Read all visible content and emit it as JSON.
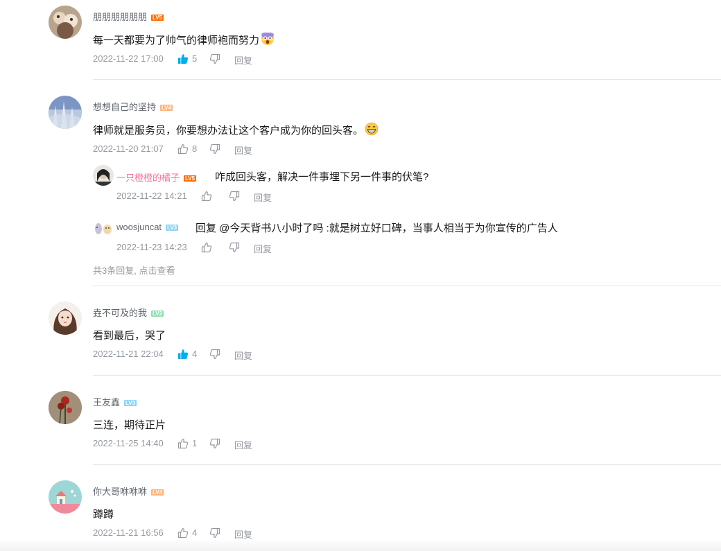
{
  "colors": {
    "like_active": "#00aeec",
    "muted": "#9499a0",
    "name": "#61666d",
    "pink_name": "#fb7299",
    "divider": "#e3e5e7"
  },
  "reply_label": "回复",
  "comments": [
    {
      "user": "朋朋朋朋朋朋",
      "level": "LV5",
      "text": "每一天都要为了帅气的律师袍而努力",
      "emoji": "scared-face-emoji",
      "time": "2022-11-22 17:00",
      "likes": "5",
      "liked": true
    },
    {
      "user": "想想自己的坚持",
      "level": "LV4",
      "text": "律师就是服务员，你要想办法让这个客户成为你的回头客。",
      "emoji": "grinning-face-emoji",
      "time": "2022-11-20 21:07",
      "likes": "8",
      "liked": false,
      "replies": [
        {
          "user": "一只橙橙的橘子",
          "level": "LV5",
          "text": "咋成回头客，解决一件事埋下另一件事的伏笔?",
          "time": "2022-11-22 14:21"
        },
        {
          "user": "woosjuncat",
          "level": "LV3",
          "text": "回复 @今天背书八小时了吗 :就是树立好口碑，当事人相当于为你宣传的广告人",
          "time": "2022-11-23 14:23"
        }
      ],
      "view_more": "共3条回复, 点击查看"
    },
    {
      "user": "垚不可及的我",
      "level": "LV2",
      "text": "看到最后，哭了",
      "time": "2022-11-21 22:04",
      "likes": "4",
      "liked": true
    },
    {
      "user": "王友鑫",
      "level": "LV3",
      "text": "三连，期待正片",
      "time": "2022-11-25 14:40",
      "likes": "1",
      "liked": false
    },
    {
      "user": "你大哥咻咻咻",
      "level": "LV4",
      "text": "蹲蹲",
      "time": "2022-11-21 16:56",
      "likes": "4",
      "liked": false
    }
  ]
}
